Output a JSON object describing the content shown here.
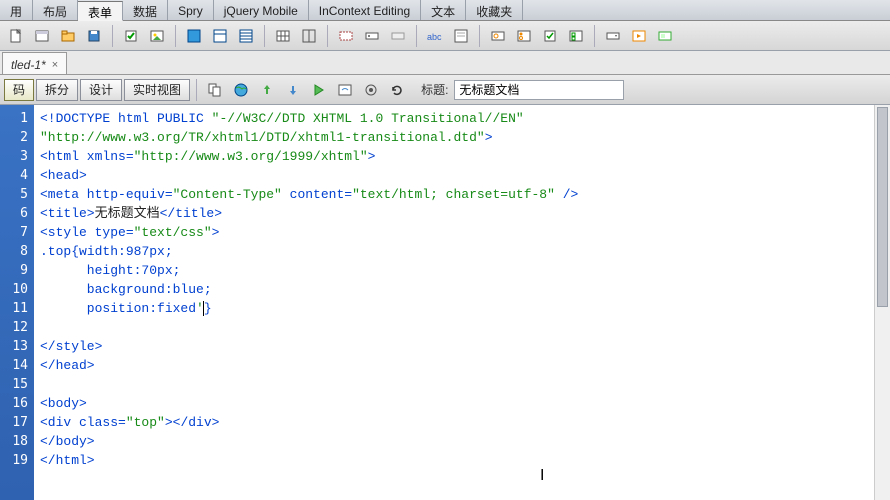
{
  "menu": {
    "items": [
      "用",
      "布局",
      "表单",
      "数据",
      "Spry",
      "jQuery Mobile",
      "InContext Editing",
      "文本",
      "收藏夹"
    ],
    "active_index": 2
  },
  "doc_tab": {
    "label": "tled-1*",
    "close": "×"
  },
  "view_buttons": {
    "code": "码",
    "split": "拆分",
    "design": "设计",
    "live": "实时视图"
  },
  "title_section": {
    "label": "标题:",
    "value": "无标题文档"
  },
  "code": {
    "lines": [
      {
        "n": 1,
        "segments": [
          {
            "t": "<!DOCTYPE html PUBLIC ",
            "c": "kw"
          },
          {
            "t": "\"-//W3C//DTD XHTML 1.0 Transitional//EN\"",
            "c": "attr-val"
          }
        ]
      },
      {
        "n": "",
        "segments": [
          {
            "t": "\"http://www.w3.org/TR/xhtml1/DTD/xhtml1-transitional.dtd\"",
            "c": "attr-val"
          },
          {
            "t": ">",
            "c": "kw"
          }
        ]
      },
      {
        "n": 2,
        "segments": [
          {
            "t": "<html xmlns=",
            "c": "kw"
          },
          {
            "t": "\"http://www.w3.org/1999/xhtml\"",
            "c": "attr-val"
          },
          {
            "t": ">",
            "c": "kw"
          }
        ]
      },
      {
        "n": 3,
        "segments": [
          {
            "t": "<head>",
            "c": "kw"
          }
        ]
      },
      {
        "n": 4,
        "segments": [
          {
            "t": "<meta http-equiv=",
            "c": "kw"
          },
          {
            "t": "\"Content-Type\"",
            "c": "attr-val"
          },
          {
            "t": " content=",
            "c": "kw"
          },
          {
            "t": "\"text/html; charset=utf-8\"",
            "c": "attr-val"
          },
          {
            "t": " />",
            "c": "kw"
          }
        ]
      },
      {
        "n": 5,
        "segments": [
          {
            "t": "<title>",
            "c": "kw"
          },
          {
            "t": "无标题文档",
            "c": "plain"
          },
          {
            "t": "</title>",
            "c": "kw"
          }
        ]
      },
      {
        "n": 6,
        "segments": [
          {
            "t": "<style type=",
            "c": "kw"
          },
          {
            "t": "\"text/css\"",
            "c": "attr-val"
          },
          {
            "t": ">",
            "c": "kw"
          }
        ]
      },
      {
        "n": 7,
        "segments": [
          {
            "t": ".top",
            "c": "kw"
          },
          {
            "t": "{",
            "c": "kw"
          },
          {
            "t": "width:987px;",
            "c": "kw"
          }
        ]
      },
      {
        "n": 8,
        "segments": [
          {
            "t": "      height:70px;",
            "c": "kw"
          }
        ]
      },
      {
        "n": 9,
        "segments": [
          {
            "t": "      background:blue;",
            "c": "kw"
          }
        ]
      },
      {
        "n": 10,
        "segments": [
          {
            "t": "      position:fixed",
            "c": "kw"
          },
          {
            "t": "'",
            "c": "attr-val",
            "caret": true
          },
          {
            "t": "}",
            "c": "kw"
          }
        ]
      },
      {
        "n": 11,
        "segments": [
          {
            "t": "",
            "c": "kw"
          }
        ]
      },
      {
        "n": 12,
        "segments": [
          {
            "t": "</style>",
            "c": "kw"
          }
        ]
      },
      {
        "n": 13,
        "segments": [
          {
            "t": "</head>",
            "c": "kw"
          }
        ]
      },
      {
        "n": 14,
        "segments": [
          {
            "t": "",
            "c": "kw"
          }
        ]
      },
      {
        "n": 15,
        "segments": [
          {
            "t": "<body>",
            "c": "kw"
          }
        ]
      },
      {
        "n": 16,
        "segments": [
          {
            "t": "<div class=",
            "c": "kw"
          },
          {
            "t": "\"top\"",
            "c": "attr-val"
          },
          {
            "t": "></div>",
            "c": "kw"
          }
        ]
      },
      {
        "n": 17,
        "segments": [
          {
            "t": "</body>",
            "c": "kw"
          }
        ]
      },
      {
        "n": 18,
        "segments": [
          {
            "t": "</html>",
            "c": "kw"
          }
        ]
      },
      {
        "n": 19,
        "segments": [
          {
            "t": "",
            "c": "kw"
          }
        ]
      }
    ]
  }
}
